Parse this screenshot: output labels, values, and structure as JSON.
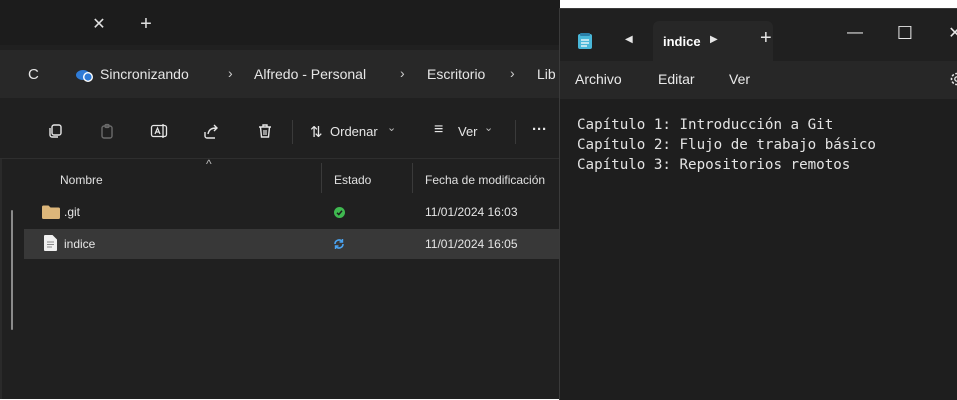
{
  "explorer": {
    "tabbar": {
      "close_icon": "close-icon",
      "newtab_icon": "plus-icon",
      "close_glyph": "✕",
      "newtab_glyph": "+"
    },
    "address": {
      "refresh_glyph": "C",
      "crumbs": [
        "Sincronizando",
        "Alfredo - Personal",
        "Escritorio",
        "Lib"
      ],
      "separator": "›"
    },
    "commands": {
      "sort_label": "Ordenar",
      "sort_glyph": "⇅",
      "view_label": "Ver",
      "view_glyph": "≡",
      "dropdown_glyph": "⌄",
      "more_glyph": "···"
    },
    "columns": {
      "name": "Nombre",
      "status": "Estado",
      "modified": "Fecha de modificación",
      "sort_glyph": "^"
    },
    "files": [
      {
        "name": ".git",
        "type": "folder",
        "status": "synced",
        "modified": "11/01/2024 16:03"
      },
      {
        "name": "indice",
        "type": "file",
        "status": "syncing",
        "modified": "11/01/2024 16:05"
      }
    ],
    "colors": {
      "folder": "#dcb67a",
      "synced": "#3fb950",
      "syncing": "#4aa3f0"
    }
  },
  "notepad": {
    "tab_title": "indice",
    "glyphs": {
      "prev": "◀",
      "next": "▶",
      "add": "+",
      "minimize": "—",
      "maximize": "☐",
      "close": "✕"
    },
    "menu": [
      "Archivo",
      "Editar",
      "Ver"
    ],
    "lines": [
      "Capítulo 1: Introducción a Git",
      "Capítulo 2: Flujo de trabajo básico",
      "Capítulo 3: Repositorios remotos"
    ]
  }
}
